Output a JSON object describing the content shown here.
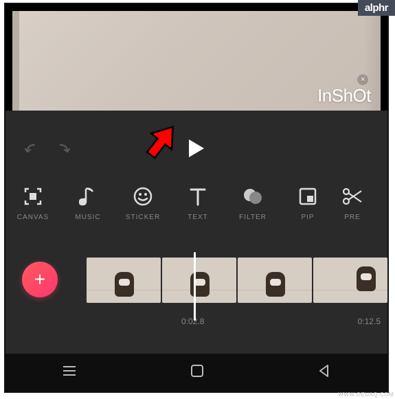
{
  "badge": "alphr",
  "watermark": "InShOt",
  "tools": [
    {
      "label": "CANVAS"
    },
    {
      "label": "MUSIC"
    },
    {
      "label": "STICKER"
    },
    {
      "label": "TEXT"
    },
    {
      "label": "FILTER"
    },
    {
      "label": "PIP"
    },
    {
      "label": "PRE"
    }
  ],
  "add_symbol": "+",
  "time": {
    "t1": "0:02.8",
    "t2": "0:12.5"
  },
  "site_mark": "WWW.OEUAQ.COM"
}
